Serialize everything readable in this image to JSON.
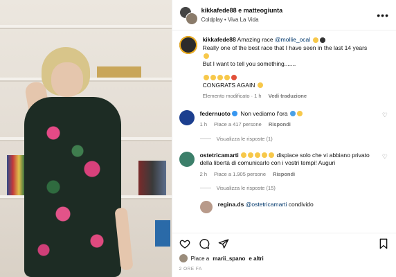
{
  "post_header": {
    "title": "kikkafede88 e matteogiunta",
    "subtitle": "Coldplay • Viva La Vida",
    "more_label": "•••"
  },
  "caption": {
    "username": "kikkafede88",
    "line1": "Amazing race",
    "mention": "@mollie_ocal",
    "line2": "Really one of the best race that I have seen in the last 14 years",
    "line3": "But I want to tell you something.......",
    "line4": "CONGRATS AGAIN",
    "meta_edited": "Elemento modificato · 1 h",
    "meta_translate": "Vedi traduzione"
  },
  "comments": [
    {
      "username": "federnuoto",
      "text": "Non vediamo l'ora",
      "time": "1 h",
      "likes": "Piace a 417 persone",
      "reply": "Rispondi",
      "view_replies": "Visualizza le risposte (1)"
    },
    {
      "username": "ostetricamarti",
      "text": "dispiace solo che vi abbiano privato della libertà di comunicarlo con i vostri tempi! Auguri",
      "time": "2 h",
      "likes": "Piace a 1.905 persone",
      "reply": "Rispondi",
      "view_replies": "Visualizza le risposte (15)"
    },
    {
      "username": "regina.ds",
      "mention": "@ostetricamarti",
      "text": "condivido"
    }
  ],
  "footer": {
    "likes_prefix": "Piace a",
    "likes_user": "marii_spano",
    "likes_suffix": "e altri",
    "timestamp": "2 ORE FA"
  },
  "colors": {
    "link": "#00376b",
    "verified": "#3797f0",
    "muted": "#737373"
  }
}
